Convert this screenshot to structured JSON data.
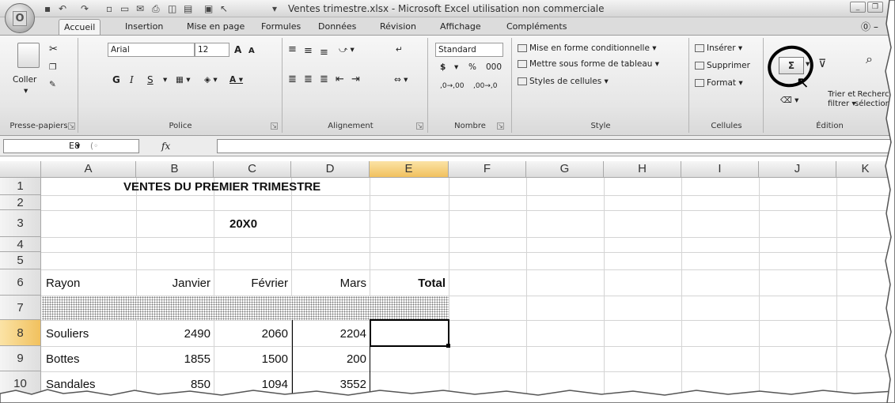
{
  "window": {
    "title": "Ventes trimestre.xlsx - Microsoft Excel utilisation non commerciale",
    "office_button": "Office"
  },
  "tabs": [
    "Accueil",
    "Insertion",
    "Mise en page",
    "Formules",
    "Données",
    "Révision",
    "Affichage",
    "Compléments"
  ],
  "ribbon": {
    "clipboard": {
      "paste_label": "Coller",
      "group_label": "Presse-papiers"
    },
    "font": {
      "name": "Arial",
      "size": "12",
      "bold": "G",
      "italic": "I",
      "underline": "S",
      "group_label": "Police"
    },
    "alignment": {
      "group_label": "Alignement"
    },
    "number": {
      "format": "Standard",
      "currency": "$",
      "percent": "%",
      "thousands": "000",
      "inc_decimal": ",0→,00",
      "dec_decimal": ",00→,0",
      "group_label": "Nombre"
    },
    "style": {
      "conditional": "Mise en forme conditionnelle",
      "as_table": "Mettre sous forme de tableau",
      "cell_styles": "Styles de cellules",
      "group_label": "Style"
    },
    "cells": {
      "insert": "Insérer",
      "delete": "Supprimer",
      "format": "Format",
      "group_label": "Cellules"
    },
    "editing": {
      "autosum": "Σ",
      "sort_filter_1": "Trier et",
      "sort_filter_2": "filtrer",
      "find_1": "Recherche",
      "find_2": "sélectionn",
      "group_label": "Édition"
    }
  },
  "formula_bar": {
    "name_box": "E8",
    "fx": "fx",
    "value": ""
  },
  "columns": [
    "A",
    "B",
    "C",
    "D",
    "E",
    "F",
    "G",
    "H",
    "I",
    "J",
    "K"
  ],
  "rows": [
    "1",
    "2",
    "3",
    "4",
    "5",
    "6",
    "7",
    "8",
    "9",
    "10"
  ],
  "sheet": {
    "title": "VENTES DU PREMIER TRIMESTRE",
    "year": "20X0",
    "headers": [
      "Rayon",
      "Janvier",
      "Février",
      "Mars",
      "Total"
    ],
    "data": [
      [
        "Souliers",
        "2490",
        "2060",
        "2204"
      ],
      [
        "Bottes",
        "1855",
        "1500",
        "200"
      ],
      [
        "Sandales",
        "850",
        "1094",
        "3552"
      ]
    ]
  },
  "colors": {
    "selection_border": "#000000",
    "highlight_circle": "#000000"
  }
}
